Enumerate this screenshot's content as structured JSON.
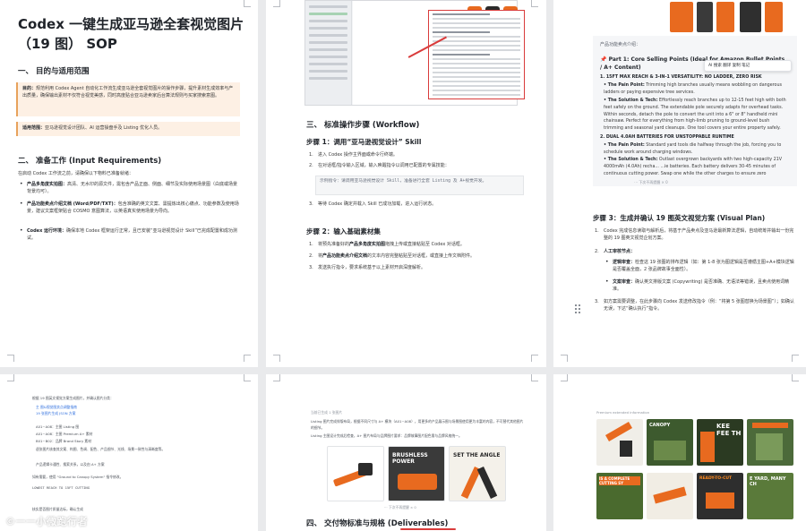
{
  "page1": {
    "title": "Codex 一键生成亚马逊全套视觉图片（19 图） SOP",
    "section1_heading": "一、 目的与适用范围",
    "purpose_label": "目的：",
    "purpose_text": "规范利用 Codex Agent 自动化工作流生成亚马逊全套视觉图片的操作步骤，提升素材生成效率与产出质量，确保输出素材不仅符合视觉美感，同时高度贴合亚马逊卖家后台算法规则与买家搜索意图。",
    "scope_label": "适用范围：",
    "scope_text": "亚马逊视觉设计团队、AI 运营操盘手及 Listing 优化人员。",
    "section2_heading": "二、 准备工作 (Input Requirements)",
    "prep_intro": "在启动 Codex 工作流之前，请确保以下物料已准备就绪：",
    "bullets": [
      {
        "label": "产品多角度实拍图：",
        "text": "高清、无水印的源文件，需包含产品正面、侧面、细节及实际使用场景图（白底或场景背景均可）。"
      },
      {
        "label": "产品功能卖点介绍文档 (Word/PDF/TXT)：",
        "text": "包含准确的英文文案、需提炼出核心痛点、功能参数及使用场景，建议文案框架贴合 COSMO 意图算法，以英语真实使用场景为导向。"
      },
      {
        "label": "Codex 运行环境：",
        "text": "确保本地 Codex 框架运行正常，且已安装“亚马逊视觉设计 Skill”已完成配置和成功测试。"
      }
    ]
  },
  "page2": {
    "screenshot_caption": "Codex 运行界面截图",
    "section3_heading": "三、 标准操作步骤 (Workflow)",
    "step1_heading": "步骤 1：调用“亚马逊视觉设计” Skill",
    "step1_items": [
      "进入 Codex 操作主界面或命令行终端。",
      "在对话框/指令输入区域，输入唤醒指令以调用已配置的专属技能："
    ],
    "step1_code": "示例指令：请调用亚马逊视觉设计 Skill，准备进行全套 Listing 及 A+视觉开发。",
    "step1_item3": "等待 Codex 确定并载入 Skill 已成功加载，进入运行状态。",
    "step2_heading": "步骤 2：输入基础素材集",
    "step2_items": [
      {
        "pre": "将预先准备好的",
        "bold": "产品多角度实拍图",
        "post": "拖拽上传或直接粘贴至 Codex 对话框。"
      },
      {
        "pre": "将",
        "bold": "产品功能卖点介绍文档",
        "post": "的文本内容完整粘贴至对话框，或直接上传文档附件。"
      },
      {
        "pre": "发送执行指令，要求系统基于以上素材开启深度解析。",
        "bold": "",
        "post": ""
      }
    ]
  },
  "page3": {
    "product_label": "产品功能卖点介绍：",
    "part_title": "Part 1: Core Selling Points (Ideal for Amazon Bullet Points / A+ Content)",
    "float_toolbar": "AI 搜索  翻译  复制  笔记",
    "lines": [
      {
        "bold": "1. 15FT MAX REACH & 3-IN-1 VERSATILITY: NO LADDER, ZERO RISK",
        "text": ""
      },
      {
        "bold": "• The Pain Point:",
        "text": " Trimming high branches usually means wobbling on dangerous ladders or paying expensive tree services."
      },
      {
        "bold": "• The Solution & Tech:",
        "text": " Effortlessly reach branches up to 12-15 feet high with both feet safely on the ground. The extendable pole securely adapts for overhead tasks. Within seconds, detach the pole to convert the unit into a 6\" or 8\" handheld mini chainsaw. Perfect for everything from high-limb pruning to ground-level bush trimming and seasonal yard cleanups. One tool covers your entire property safely."
      },
      {
        "bold": "2. DUAL 4.0AH BATTERIES FOR UNSTOPPABLE RUNTIME",
        "text": ""
      },
      {
        "bold": "• The Pain Point:",
        "text": " Standard yard tools die halfway through the job, forcing you to schedule work around charging windows."
      },
      {
        "bold": "• The Solution & Tech:",
        "text": " Outlast overgrown backyards with two high-capacity 21V 4000mAh (4.0Ah) recha... ...ie batteries. Each battery delivers 30-45 minutes of continuous cutting power. Swap one while the other charges to ensure zero"
      }
    ],
    "footbar": "⋯  下次不再提醒  × 0",
    "step3_heading": "步骤 3：生成并确认 19 图英文视觉方案 (Visual Plan)",
    "step3_items": [
      "Codex 完成信息读取与解析后，将基于产品卖点及亚马逊最新算法逻辑，自动统筹并输出一份完整的 19 图英文视觉企划方案。",
      "人工审核节点："
    ],
    "review_items": [
      {
        "label": "逻辑审查：",
        "text": "检查这 19 张图的排布逻辑（如：第 1-8 张为图逻辑是否遵循主图+A+模块逻辑是否覆盖全面，2 张品牌故事全面性）。"
      },
      {
        "label": "文案审查：",
        "text": "确认英文排版文案 (Copywriting) 是否准确、无语法等错误，且卖点使用词精准。"
      }
    ],
    "step3_item3": "如方案需要调整，在此步骤向 Codex 发送修改指令（例：“将第 5 张图替换为场景图”）；如确认无误，下达“确认执行”指令。"
  },
  "page4": {
    "intro": "根据 19 图英文视觉方案生成图片，并确认图片分类：",
    "links": [
      "主 图&视觉图卖点调整指南",
      "19 张图片生成 JSON 方案"
    ],
    "items": [
      "A01~A08：主图 Listing 图",
      "A01~A08：主图 Premium A+ 素材",
      "B01~B02：品牌 Brand Story 素材",
      "逐张图片核查其文案、构图、色调、配色、产品细节、光线、场景一致性与清晰度等。",
      "产品逻辑卡通性、搜索关系，以及由 A+ 方案"
    ],
    "verify": "如有需要，使用 \"Ground to Canopy System\" 指令修改。",
    "code_line": "LOWEST REACH TO 15FT CUTTING",
    "bottom_text": "核实是否图片质量达标，确认生成"
  },
  "page5": {
    "caption": "当前已生成 1 张图片",
    "para1": "Listing 图片完成排版布局，根据不同尺寸与 A+ 模块（A01~A08），用更多的产品展示图与场景图使用更为丰富的内容，不可替代其他图片的细节。",
    "para2": "Listing 主图设计完成后检查，A+ 图片布局与品牌图片要求：品牌故事图片配色需与品牌风格统一。",
    "cards": [
      {
        "title": "",
        "sub": ""
      },
      {
        "title": "BRUSHLESS POWER",
        "sub": ""
      },
      {
        "title": "SET THE ANGLE",
        "sub": ""
      }
    ],
    "card1_label": "",
    "footbar": "⋯  下次不再提醒  × 0",
    "section4_heading": "四、 交付物标准与规格 (Deliverables)"
  },
  "page6": {
    "header": "Premium extended information",
    "thumbs_row1": [
      {
        "text": "",
        "style": "white"
      },
      {
        "text": "CANOPY",
        "style": "white"
      },
      {
        "text": "KEE FEE TH",
        "style": "white"
      },
      {
        "text": "",
        "style": "white"
      }
    ],
    "thumbs_row2": [
      {
        "text": "IS A COMPLETE CUTTING SY",
        "style": "white"
      },
      {
        "text": "",
        "style": "white"
      },
      {
        "text": "READY-TO-CUT",
        "style": "orange"
      },
      {
        "text": "E YARD, MANY CH",
        "style": "white"
      }
    ]
  },
  "watermark": "©一一小微跑行者"
}
